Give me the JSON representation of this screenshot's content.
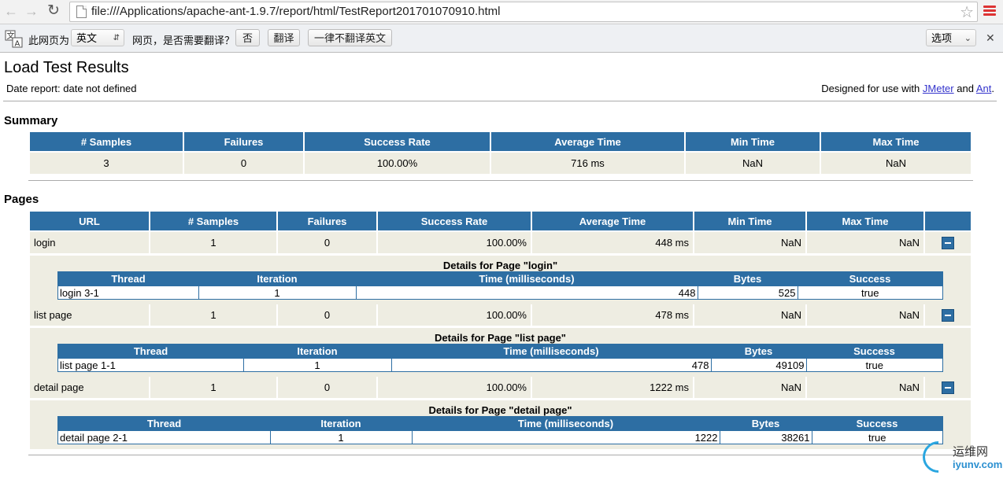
{
  "browser": {
    "url": "file:///Applications/apache-ant-1.9.7/report/html/TestReport201701070910.html"
  },
  "translate_bar": {
    "prompt_label": "此网页为",
    "language": "英文",
    "question": "网页，是否需要翻译？",
    "no_button": "否",
    "translate_button": "翻译",
    "never_button": "一律不翻译英文",
    "options_label": "选项"
  },
  "report": {
    "title": "Load Test Results",
    "date_report": "Date report: date not defined",
    "designed_prefix": "Designed for use with",
    "jmeter_link": "JMeter",
    "and_text": "and",
    "ant_link": "Ant",
    "period": ".",
    "summary_heading": "Summary",
    "pages_heading": "Pages"
  },
  "summary": {
    "headers": [
      "# Samples",
      "Failures",
      "Success Rate",
      "Average Time",
      "Min Time",
      "Max Time"
    ],
    "values": [
      "3",
      "0",
      "100.00%",
      "716 ms",
      "NaN",
      "NaN"
    ]
  },
  "pages": {
    "headers": [
      "URL",
      "# Samples",
      "Failures",
      "Success Rate",
      "Average Time",
      "Min Time",
      "Max Time"
    ],
    "detail_headers": [
      "Thread",
      "Iteration",
      "Time (milliseconds)",
      "Bytes",
      "Success"
    ],
    "rows": [
      {
        "url": "login",
        "samples": "1",
        "failures": "0",
        "success_rate": "100.00%",
        "avg": "448 ms",
        "min": "NaN",
        "max": "NaN",
        "detail_title": "Details for Page \"login\"",
        "detail": {
          "thread": "login 3-1",
          "iteration": "1",
          "time": "448",
          "bytes": "525",
          "success": "true"
        }
      },
      {
        "url": "list page",
        "samples": "1",
        "failures": "0",
        "success_rate": "100.00%",
        "avg": "478 ms",
        "min": "NaN",
        "max": "NaN",
        "detail_title": "Details for Page \"list page\"",
        "detail": {
          "thread": "list page 1-1",
          "iteration": "1",
          "time": "478",
          "bytes": "49109",
          "success": "true"
        }
      },
      {
        "url": "detail page",
        "samples": "1",
        "failures": "0",
        "success_rate": "100.00%",
        "avg": "1222 ms",
        "min": "NaN",
        "max": "NaN",
        "detail_title": "Details for Page \"detail page\"",
        "detail": {
          "thread": "detail page 2-1",
          "iteration": "1",
          "time": "1222",
          "bytes": "38261",
          "success": "true"
        }
      }
    ]
  },
  "watermark": {
    "cn": "运维网",
    "url": "iyunv.com"
  }
}
